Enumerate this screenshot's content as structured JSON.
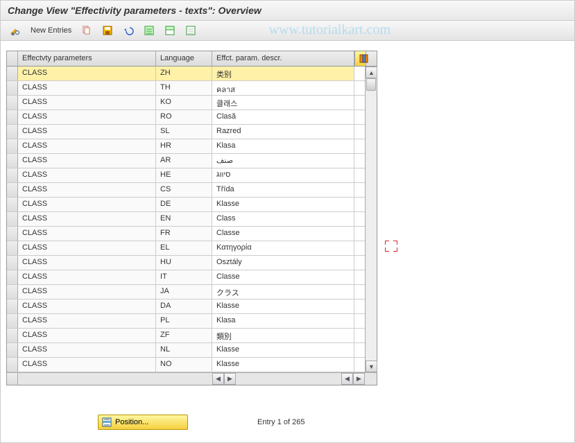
{
  "title": "Change View \"Effectivity parameters - texts\": Overview",
  "watermark": "www.tutorialkart.com",
  "toolbar": {
    "new_entries": "New Entries"
  },
  "grid": {
    "columns": {
      "param": "Effectvty parameters",
      "lang": "Language",
      "descr": "Effct. param. descr."
    },
    "rows": [
      {
        "param": "CLASS",
        "lang": "ZH",
        "descr": "类别",
        "selected": true
      },
      {
        "param": "CLASS",
        "lang": "TH",
        "descr": "คลาส"
      },
      {
        "param": "CLASS",
        "lang": "KO",
        "descr": "클래스"
      },
      {
        "param": "CLASS",
        "lang": "RO",
        "descr": "Clasă"
      },
      {
        "param": "CLASS",
        "lang": "SL",
        "descr": "Razred"
      },
      {
        "param": "CLASS",
        "lang": "HR",
        "descr": "Klasa"
      },
      {
        "param": "CLASS",
        "lang": "AR",
        "descr": "صنف"
      },
      {
        "param": "CLASS",
        "lang": "HE",
        "descr": "סיווג"
      },
      {
        "param": "CLASS",
        "lang": "CS",
        "descr": "Třída"
      },
      {
        "param": "CLASS",
        "lang": "DE",
        "descr": "Klasse"
      },
      {
        "param": "CLASS",
        "lang": "EN",
        "descr": "Class"
      },
      {
        "param": "CLASS",
        "lang": "FR",
        "descr": "Classe"
      },
      {
        "param": "CLASS",
        "lang": "EL",
        "descr": "Κατηγορία"
      },
      {
        "param": "CLASS",
        "lang": "HU",
        "descr": "Osztály"
      },
      {
        "param": "CLASS",
        "lang": "IT",
        "descr": "Classe"
      },
      {
        "param": "CLASS",
        "lang": "JA",
        "descr": "クラス"
      },
      {
        "param": "CLASS",
        "lang": "DA",
        "descr": "Klasse"
      },
      {
        "param": "CLASS",
        "lang": "PL",
        "descr": "Klasa"
      },
      {
        "param": "CLASS",
        "lang": "ZF",
        "descr": "類別"
      },
      {
        "param": "CLASS",
        "lang": "NL",
        "descr": "Klasse"
      },
      {
        "param": "CLASS",
        "lang": "NO",
        "descr": "Klasse"
      }
    ]
  },
  "footer": {
    "position": "Position...",
    "entry": "Entry 1 of 265"
  }
}
